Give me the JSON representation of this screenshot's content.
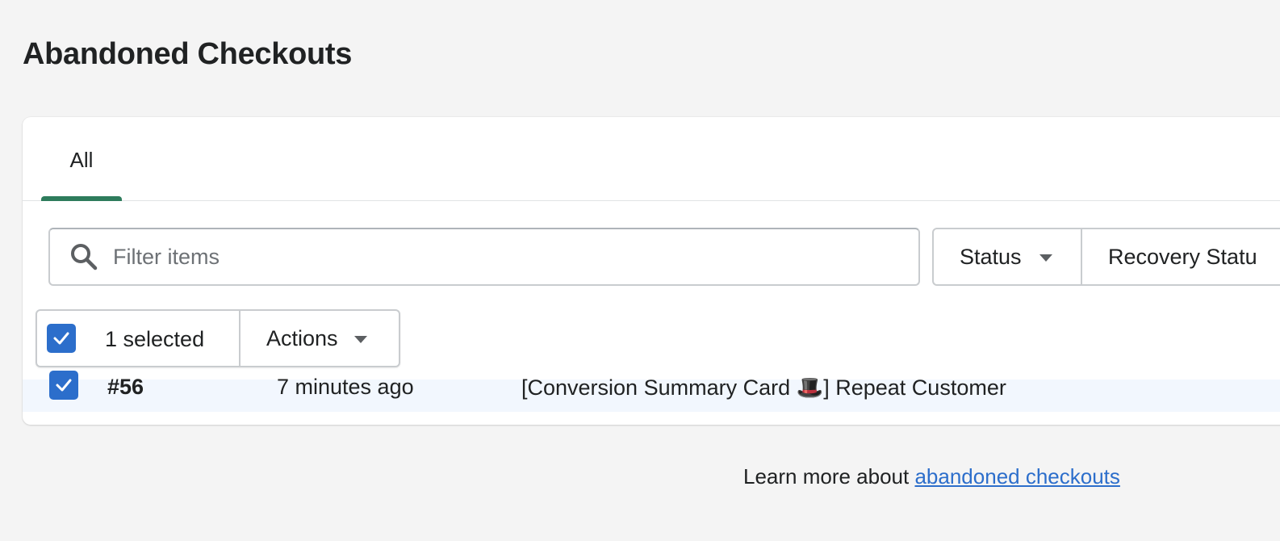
{
  "page": {
    "title": "Abandoned Checkouts"
  },
  "tabs": [
    {
      "label": "All",
      "selected": true
    }
  ],
  "search": {
    "placeholder": "Filter items",
    "value": "",
    "icon": "search-icon"
  },
  "filters": {
    "status_label": "Status",
    "recovery_status_label": "Recovery Statu"
  },
  "bulk_actions": {
    "selected_count": "1 selected",
    "actions_label": "Actions",
    "checked": true
  },
  "table": {
    "rows": [
      {
        "checkout_id": "#56",
        "date": "7 minutes ago",
        "customer": "[Conversion Summary Card 🎩] Repeat Customer",
        "checked": true
      }
    ]
  },
  "footer": {
    "text": "Learn more about ",
    "link_label": "abandoned checkouts"
  },
  "colors": {
    "accent": "#2c6ecb",
    "tab_indicator": "#2e7c5c",
    "selected_row": "#f2f7fe",
    "page_bg": "#f4f4f4"
  }
}
